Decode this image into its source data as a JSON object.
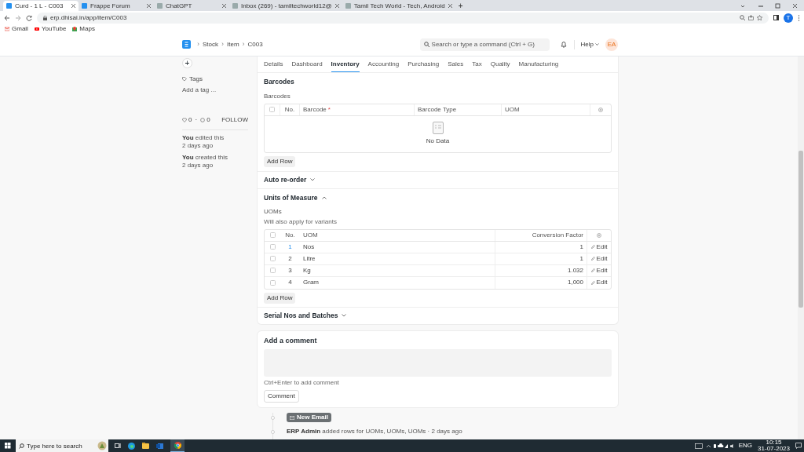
{
  "browser": {
    "tabs": [
      {
        "title": "Curd - 1 L - C003",
        "selected": true
      },
      {
        "title": "Frappe Forum",
        "selected": false
      },
      {
        "title": "ChatGPT",
        "selected": false
      },
      {
        "title": "Inbox (269) - tamiltechworld12@",
        "selected": false
      },
      {
        "title": "Tamil Tech World - Tech, Android",
        "selected": false
      }
    ],
    "new_tab": "+",
    "url": "erp.dhisai.in/app/item/C003",
    "profile": "T",
    "bookmarks": [
      "Gmail",
      "YouTube",
      "Maps"
    ]
  },
  "navbar": {
    "breadcrumbs": [
      "Stock",
      "Item",
      "C003"
    ],
    "separator": "›",
    "search": {
      "placeholder": "Search or type a command (Ctrl + G)"
    },
    "help": "Help",
    "avatar": "EA"
  },
  "sidebar": {
    "add": "+",
    "tags_label": "Tags",
    "add_tag": "Add a tag ...",
    "likes": "0",
    "dot": "·",
    "comments": "0",
    "follow": "FOLLOW",
    "activity": [
      {
        "who": "You",
        "what": "edited this",
        "when": "2 days ago"
      },
      {
        "who": "You",
        "what": "created this",
        "when": "2 days ago"
      }
    ]
  },
  "form_tabs": [
    {
      "label": "Details",
      "selected": false
    },
    {
      "label": "Dashboard",
      "selected": false
    },
    {
      "label": "Inventory",
      "selected": true
    },
    {
      "label": "Accounting",
      "selected": false
    },
    {
      "label": "Purchasing",
      "selected": false
    },
    {
      "label": "Sales",
      "selected": false
    },
    {
      "label": "Tax",
      "selected": false
    },
    {
      "label": "Quality",
      "selected": false
    },
    {
      "label": "Manufacturing",
      "selected": false
    }
  ],
  "barcodes": {
    "heading": "Barcodes",
    "label": "Barcodes",
    "all_checked": false,
    "required_marker": "*",
    "columns": [
      {
        "label": "No.",
        "required": false
      },
      {
        "label": "Barcode",
        "required": true
      },
      {
        "label": "Barcode Type",
        "required": false
      },
      {
        "label": "UOM",
        "required": false
      }
    ],
    "empty": "No Data",
    "add_row": "Add Row"
  },
  "sections": [
    {
      "title": "Auto re-order",
      "expanded": false
    }
  ],
  "uom": {
    "title": "Units of Measure",
    "expanded": true,
    "label": "UOMs",
    "hint": "Will also apply for variants",
    "all_checked": false,
    "columns": [
      "No.",
      "UOM",
      "Conversion Factor"
    ],
    "rows": [
      {
        "no": "1",
        "uom": "Nos",
        "factor": "1",
        "edit": "Edit",
        "checked": false
      },
      {
        "no": "2",
        "uom": "Litre",
        "factor": "1",
        "edit": "Edit",
        "checked": false
      },
      {
        "no": "3",
        "uom": "Kg",
        "factor": "1.032",
        "edit": "Edit",
        "checked": false
      },
      {
        "no": "4",
        "uom": "Gram",
        "factor": "1,000",
        "edit": "Edit",
        "checked": false
      }
    ],
    "add_row": "Add Row"
  },
  "serial": {
    "title": "Serial Nos and Batches",
    "expanded": false
  },
  "comment": {
    "heading": "Add a comment",
    "hint": "Ctrl+Enter to add comment",
    "button": "Comment"
  },
  "timeline": {
    "new_email": "New Email",
    "events": [
      {
        "who": "ERP Admin",
        "what": "added rows for UOMs, UOMs, UOMs · 2 days ago"
      }
    ]
  },
  "taskbar": {
    "search": {
      "placeholder": "Type here to search"
    },
    "lang": "ENG",
    "time": "10:15",
    "date": "31-07-2023"
  }
}
